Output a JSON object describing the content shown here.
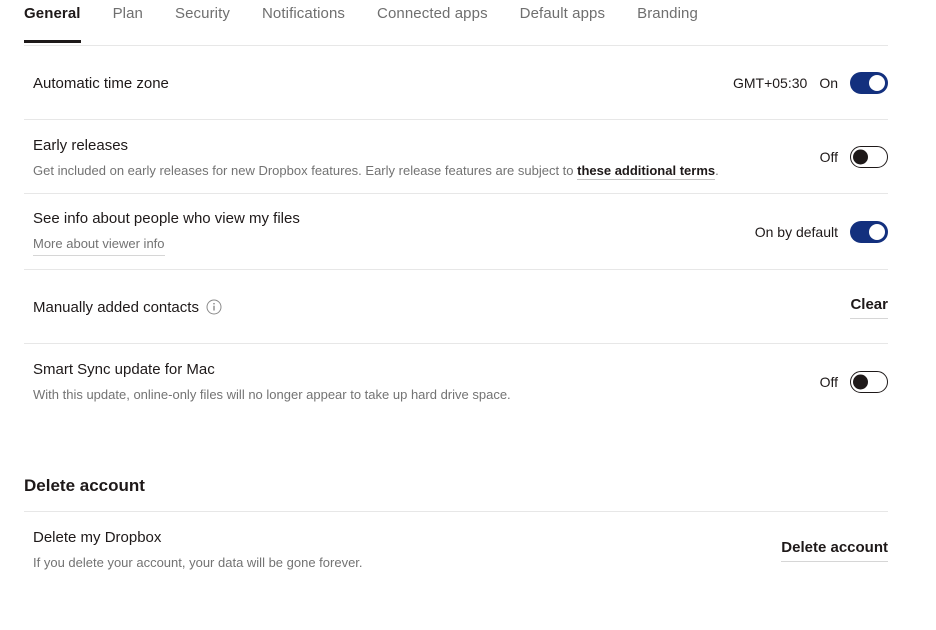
{
  "tabs": [
    {
      "label": "General",
      "active": true
    },
    {
      "label": "Plan",
      "active": false
    },
    {
      "label": "Security",
      "active": false
    },
    {
      "label": "Notifications",
      "active": false
    },
    {
      "label": "Connected apps",
      "active": false
    },
    {
      "label": "Default apps",
      "active": false
    },
    {
      "label": "Branding",
      "active": false
    }
  ],
  "colors": {
    "toggle_on": "#13307e",
    "toggle_off_border": "#1e1919",
    "text_primary": "#1e1919",
    "text_secondary": "#737373",
    "divider": "#e7e7e7"
  },
  "settings": {
    "automatic_time_zone": {
      "title": "Automatic time zone",
      "timezone": "GMT+05:30",
      "state_label": "On"
    },
    "early_releases": {
      "title": "Early releases",
      "desc_prefix": "Get included on early releases for new Dropbox features. Early release features are subject to ",
      "desc_link": "these additional terms",
      "desc_suffix": ".",
      "state_label": "Off"
    },
    "viewer_info": {
      "title": "See info about people who view my files",
      "link": "More about viewer info",
      "state_label": "On by default"
    },
    "manually_added_contacts": {
      "title": "Manually added contacts",
      "info_icon": "info-circle-icon",
      "action_label": "Clear"
    },
    "smart_sync": {
      "title": "Smart Sync update for Mac",
      "desc": "With this update, online-only files will no longer appear to take up hard drive space.",
      "state_label": "Off"
    }
  },
  "delete_account": {
    "section_title": "Delete account",
    "row_title": "Delete my Dropbox",
    "row_desc": "If you delete your account, your data will be gone forever.",
    "action_label": "Delete account"
  }
}
